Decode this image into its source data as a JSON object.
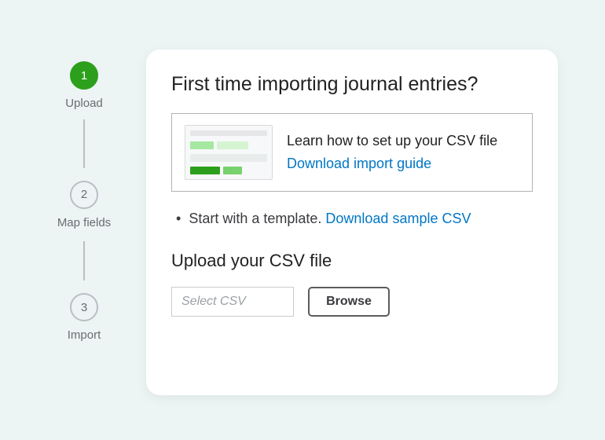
{
  "stepper": {
    "steps": [
      {
        "num": "1",
        "label": "Upload",
        "active": true
      },
      {
        "num": "2",
        "label": "Map fields",
        "active": false
      },
      {
        "num": "3",
        "label": "Import",
        "active": false
      }
    ]
  },
  "card": {
    "heading": "First time importing journal entries?",
    "guide": {
      "title": "Learn how to set up your CSV file",
      "link_label": "Download import guide"
    },
    "template_text": "Start with a template. ",
    "template_link": "Download sample CSV",
    "upload_heading": "Upload your CSV file",
    "file_placeholder": "Select CSV",
    "browse_label": "Browse"
  }
}
